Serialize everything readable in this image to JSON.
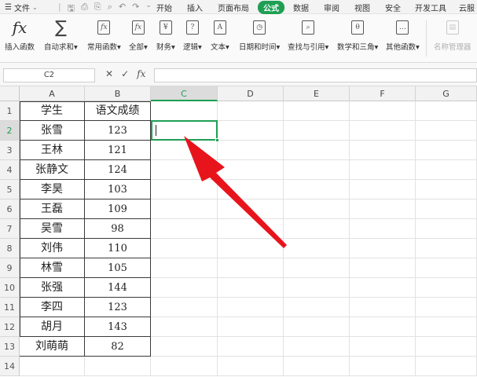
{
  "menubar": {
    "file_label": "文件",
    "tabs": [
      {
        "label": "开始",
        "active": false
      },
      {
        "label": "插入",
        "active": false
      },
      {
        "label": "页面布局",
        "active": false
      },
      {
        "label": "公式",
        "active": true
      },
      {
        "label": "数据",
        "active": false
      },
      {
        "label": "审阅",
        "active": false
      },
      {
        "label": "视图",
        "active": false
      },
      {
        "label": "安全",
        "active": false
      },
      {
        "label": "开发工具",
        "active": false
      },
      {
        "label": "云服",
        "active": false
      }
    ],
    "accent_color": "#1e9f54"
  },
  "ribbon": {
    "insert_function": "插入函数",
    "autosum": "自动求和",
    "common_functions": "常用函数",
    "all": "全部",
    "finance": "财务",
    "logic": "逻辑",
    "text": "文本",
    "datetime": "日期和时间",
    "lookup": "查找与引用",
    "math_trig": "数学和三角",
    "other_functions": "其他函数",
    "name_manager": "名称管理器"
  },
  "formula_bar": {
    "name_box": "C2",
    "formula": ""
  },
  "columns": [
    "A",
    "B",
    "C",
    "D",
    "E",
    "F",
    "G"
  ],
  "rows": [
    "1",
    "2",
    "3",
    "4",
    "5",
    "6",
    "7",
    "8",
    "9",
    "10",
    "11",
    "12",
    "13",
    "14"
  ],
  "selected_cell": "C2",
  "table": {
    "header": [
      "学生",
      "语文成绩"
    ],
    "rows": [
      [
        "张雪",
        "123"
      ],
      [
        "王林",
        "121"
      ],
      [
        "张静文",
        "124"
      ],
      [
        "李昊",
        "103"
      ],
      [
        "王磊",
        "109"
      ],
      [
        "吴雪",
        "98"
      ],
      [
        "刘伟",
        "110"
      ],
      [
        "林雪",
        "105"
      ],
      [
        "张强",
        "144"
      ],
      [
        "李四",
        "123"
      ],
      [
        "胡月",
        "143"
      ],
      [
        "刘萌萌",
        "82"
      ]
    ]
  },
  "annotation_color": "#e8141c"
}
